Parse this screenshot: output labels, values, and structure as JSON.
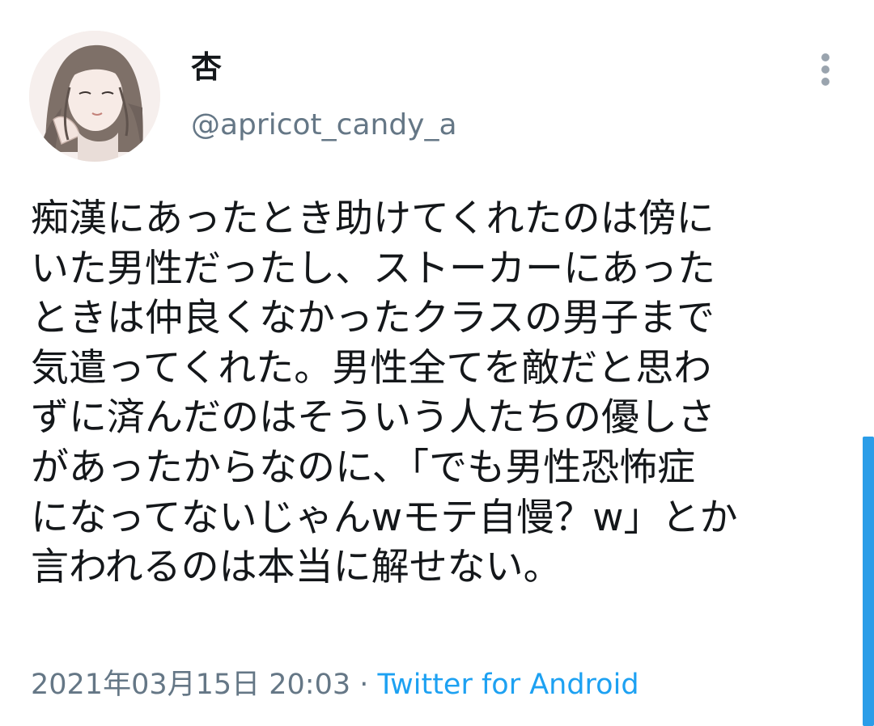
{
  "tweet": {
    "display_name": "杏",
    "handle": "@apricot_candy_a",
    "text_lines": [
      "痴漢にあったとき助けてくれたのは傍に",
      "いた男性だったし、ストーカーにあった",
      "ときは仲良くなかったクラスの男子まで",
      "気遣ってくれた。男性全てを敵だと思わ",
      "ずに済んだのはそういう人たちの優しさ",
      "があったからなのに、「でも男性恐怖症",
      "になってないじゃんwモテ自慢？w」とか",
      "言われるのは本当に解せない。"
    ],
    "timestamp": "2021年03月15日 20:03",
    "separator": " · ",
    "source": "Twitter for Android"
  },
  "icons": {
    "menu": "more-vertical-icon",
    "avatar": "user-avatar-illustration"
  },
  "colors": {
    "text": "#14171a",
    "secondary": "#657786",
    "link": "#1da1f2",
    "scrollbar": "#2b9de8"
  }
}
